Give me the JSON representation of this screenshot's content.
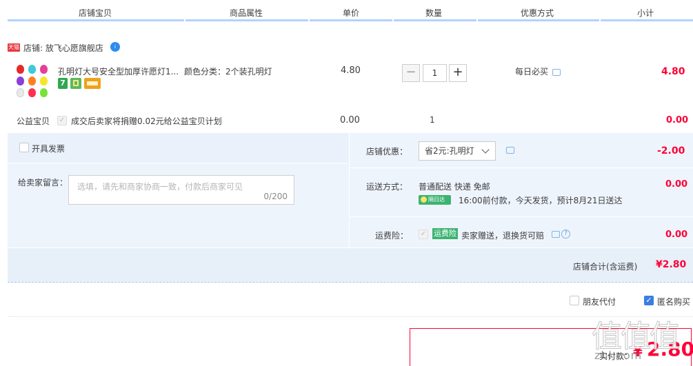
{
  "header": {
    "columns": [
      "店铺宝贝",
      "商品属性",
      "单价",
      "数量",
      "优惠方式",
      "小计"
    ]
  },
  "shop": {
    "badge": "天猫",
    "name": "店铺: 放飞心愿旗舰店",
    "chat_badge": "i"
  },
  "item": {
    "title": "孔明灯大号安全型加厚许愿灯1...",
    "attribute": "颜色分类：2个装孔明灯",
    "price": "4.80",
    "quantity": "1",
    "minus": "−",
    "plus": "+",
    "promotion": "每日必买",
    "subtotal": "4.80",
    "service_icons": [
      "7day-return-icon",
      "guarantee-icon",
      "card-icon"
    ],
    "thumb_colors": [
      "#e52a2a",
      "#3fc9d9",
      "#e53f9a",
      "#8b3fd6",
      "#ff7f1e",
      "#f5e628",
      "#e9e9e9",
      "#ff3050",
      "#7be03a"
    ]
  },
  "charity": {
    "label": "公益宝贝",
    "text": "成交后卖家将捐赠0.02元给公益宝贝计划",
    "price": "0.00",
    "quantity": "1",
    "subtotal": "0.00"
  },
  "invoice": {
    "label": "开具发票"
  },
  "message": {
    "label": "给卖家留言：",
    "placeholder": "选填，请先和商家协商一致，付款后商家可见",
    "count": "0/200"
  },
  "coupon": {
    "label": "店铺优惠：",
    "selected": "省2元:孔明灯",
    "amount": "-2.00"
  },
  "shipping": {
    "label": "运送方式：",
    "method": "普通配送 快递 免邮",
    "badge": "隔日达",
    "note": "16:00前付款，今天发货，预计8月21日送达",
    "amount": "0.00"
  },
  "insurance": {
    "label": "运费险：",
    "badge": "运费险",
    "text": "卖家赠送，退换货可赔",
    "help": "?",
    "amount": "0.00"
  },
  "shop_total": {
    "label": "店铺合计(含运费)",
    "amount": "¥2.80"
  },
  "options": {
    "friend_pay": "朋友代付",
    "anonymous": "匿名购买",
    "anonymous_checked": true
  },
  "final": {
    "label": "实付款：",
    "yen": "¥",
    "amount": "2.80"
  },
  "watermark": {
    "chars": "值值值",
    "url": "zhi.com"
  },
  "colors": {
    "accent_red": "#ff0036",
    "panel_blue": "#eef4fc",
    "header_line": "#b2d1ff",
    "checkbox_blue": "#3a7ee0"
  }
}
